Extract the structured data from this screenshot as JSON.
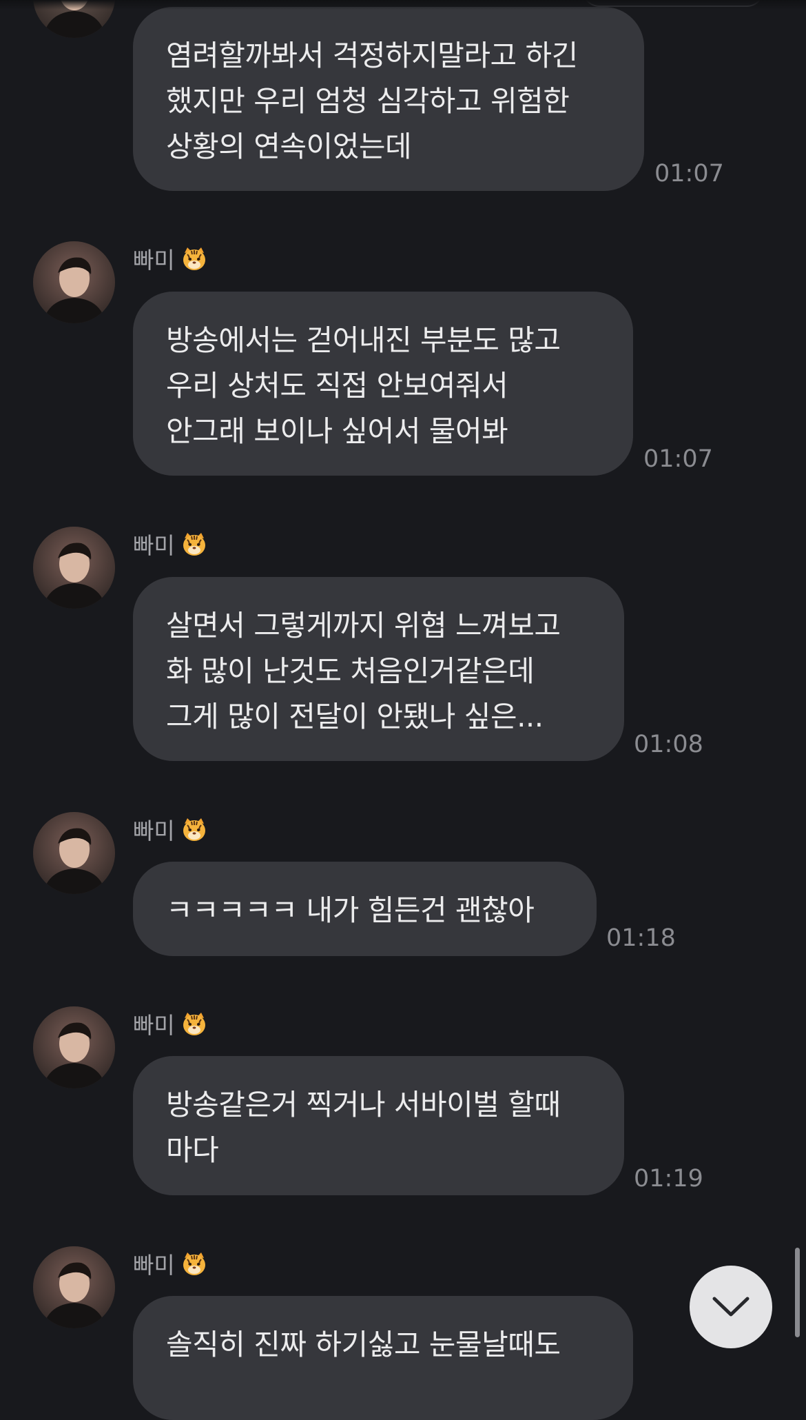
{
  "sender": {
    "name": "빠미",
    "emoji": "tiger-face-emoji"
  },
  "messages": [
    {
      "text": "염려할까봐서 걱정하지말라고 하긴\n했지만 우리 엄청 심각하고 위험한\n상황의 연속이었는데",
      "time": "01:07"
    },
    {
      "text": "방송에서는 걷어내진 부분도 많고\n우리 상처도 직접 안보여줘서\n안그래 보이나 싶어서 물어봐",
      "time": "01:07"
    },
    {
      "text": "살면서 그렇게까지 위협 느껴보고\n화 많이 난것도 처음인거같은데\n그게 많이 전달이 안됐나 싶은...",
      "time": "01:08"
    },
    {
      "text": "ㅋㅋㅋㅋㅋ 내가 힘든건 괜찮아",
      "time": "01:18"
    },
    {
      "text": "방송같은거 찍거나 서바이벌 할때\n마다",
      "time": "01:19"
    },
    {
      "text": "솔직히 진짜 하기싫고 눈물날때도",
      "time": ""
    }
  ],
  "icons": {
    "scroll_down": "chevron-down-icon"
  },
  "colors": {
    "background": "#18191d",
    "bubble": "#36373c",
    "text": "#ececed",
    "timestamp": "#8b8c91",
    "sender_name": "#a4a5aa",
    "scroll_button": "#e4e4e6"
  }
}
